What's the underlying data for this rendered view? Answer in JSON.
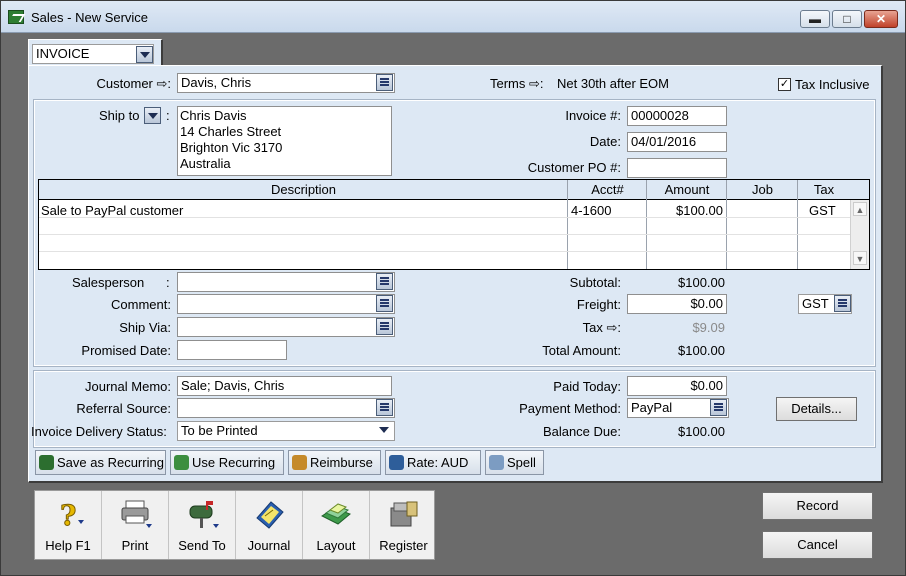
{
  "window": {
    "title": "Sales - New Service"
  },
  "layout": {
    "value": "INVOICE"
  },
  "header": {
    "customer_label": "Customer ⇨:",
    "customer_value": "Davis, Chris",
    "terms_label": "Terms ⇨:",
    "terms_value": "Net 30th after EOM",
    "tax_inclusive_label": "Tax Inclusive",
    "tax_inclusive_checked": true
  },
  "ship_to": {
    "label": "Ship to",
    "colon": ":",
    "lines": [
      "Chris Davis",
      "14 Charles Street",
      "Brighton  Vic  3170",
      "Australia"
    ]
  },
  "invoice": {
    "number_label": "Invoice #:",
    "number_value": "00000028",
    "date_label": "Date:",
    "date_value": "04/01/2016",
    "po_label": "Customer PO #:",
    "po_value": ""
  },
  "lines_table": {
    "headers": [
      "Description",
      "Acct#",
      "Amount",
      "Job",
      "Tax"
    ],
    "rows": [
      {
        "description": "Sale to PayPal customer",
        "acct": "4-1600",
        "amount": "$100.00",
        "job": "",
        "tax": "GST"
      }
    ]
  },
  "details": {
    "salesperson_label": "Salesperson",
    "salesperson_colon": ":",
    "comment_label": "Comment:",
    "shipvia_label": "Ship Via:",
    "promised_label": "Promised Date:"
  },
  "totals": {
    "subtotal_label": "Subtotal:",
    "subtotal_value": "$100.00",
    "freight_label": "Freight:",
    "freight_value": "$0.00",
    "freight_tax": "GST",
    "tax_label": "Tax ⇨:",
    "tax_value": "$9.09",
    "total_label": "Total Amount:",
    "total_value": "$100.00"
  },
  "payment": {
    "memo_label": "Journal Memo:",
    "memo_value": "Sale; Davis, Chris",
    "referral_label": "Referral Source:",
    "delivery_label": "Invoice Delivery Status:",
    "delivery_value": "To be Printed",
    "paid_today_label": "Paid Today:",
    "paid_today_value": "$0.00",
    "method_label": "Payment Method:",
    "method_value": "PayPal",
    "balance_label": "Balance Due:",
    "balance_value": "$100.00",
    "details_button": "Details..."
  },
  "actions": {
    "save_recurring": "Save as Recurring",
    "use_recurring": "Use Recurring",
    "reimburse": "Reimburse",
    "rate": "Rate:  AUD",
    "spell": "Spell"
  },
  "toolbar": {
    "help": "Help F1",
    "print": "Print",
    "send_to": "Send To",
    "journal": "Journal",
    "layout": "Layout",
    "register": "Register"
  },
  "buttons": {
    "record": "Record",
    "cancel": "Cancel"
  }
}
